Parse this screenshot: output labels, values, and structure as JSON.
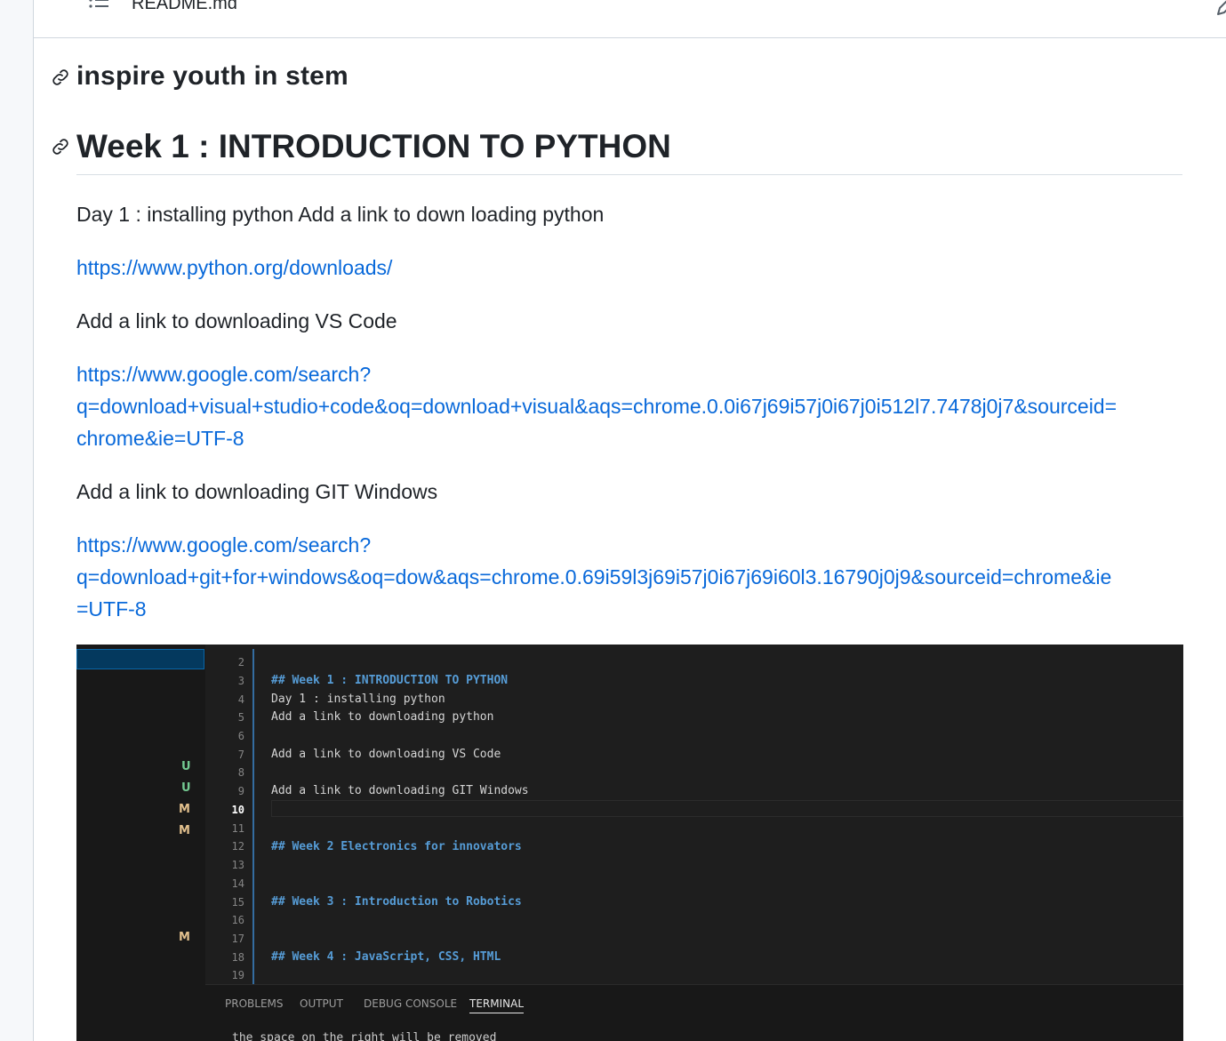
{
  "file_header": {
    "file_name": "README.md",
    "toc_icon": "list-unordered-icon",
    "edit_icon": "pencil-icon"
  },
  "readme": {
    "heading1": "inspire youth in stem",
    "heading2": "Week 1 : INTRODUCTION TO PYTHON",
    "para_day1": "Day 1 : installing python Add a link to down loading python",
    "link_python": "https://www.python.org/downloads/",
    "para_vscode": "Add a link to downloading VS Code",
    "link_vscode": [
      "https://www.google.com/search?",
      "q=download+visual+studio+code&oq=download+visual&aqs=chrome.0.0i67j69i57j0i67j0i512l7.7478j0j7&sourceid=",
      "chrome&ie=UTF-8"
    ],
    "para_git": "Add a link to downloading GIT Windows",
    "link_git": [
      "https://www.google.com/search?",
      "q=download+git+for+windows&oq=dow&aqs=chrome.0.69i59l3j69i57j0i67j69i60l3.16790j0j9&sourceid=chrome&ie",
      "=UTF-8"
    ],
    "anchor_icon": "link-icon"
  },
  "screenshot": {
    "git_badges": [
      "U",
      "U",
      "M",
      "M",
      "M"
    ],
    "badge_colors": {
      "U": "#73c991",
      "M": "#e2c08d"
    },
    "line_numbers": [
      "2",
      "3",
      "4",
      "5",
      "6",
      "7",
      "8",
      "9",
      "10",
      "11",
      "12",
      "13",
      "14",
      "15",
      "16",
      "17",
      "18",
      "19"
    ],
    "active_line": "10",
    "code_lines": {
      "l3": "## Week 1 : INTRODUCTION TO PYTHON",
      "l4": "Day 1 : installing python",
      "l5": "Add a link to downloading python",
      "l7": "Add a link to downloading VS Code",
      "l9": "Add a link to downloading GIT Windows",
      "l12": "## Week 2 Electronics for innovators",
      "l15": "## Week 3 : Introduction to Robotics",
      "l18": "## Week 4 : JavaScript, CSS, HTML"
    },
    "panel_tabs": [
      "PROBLEMS",
      "OUTPUT",
      "DEBUG CONSOLE",
      "TERMINAL"
    ],
    "terminal_text": "the space on the right will be removed"
  }
}
